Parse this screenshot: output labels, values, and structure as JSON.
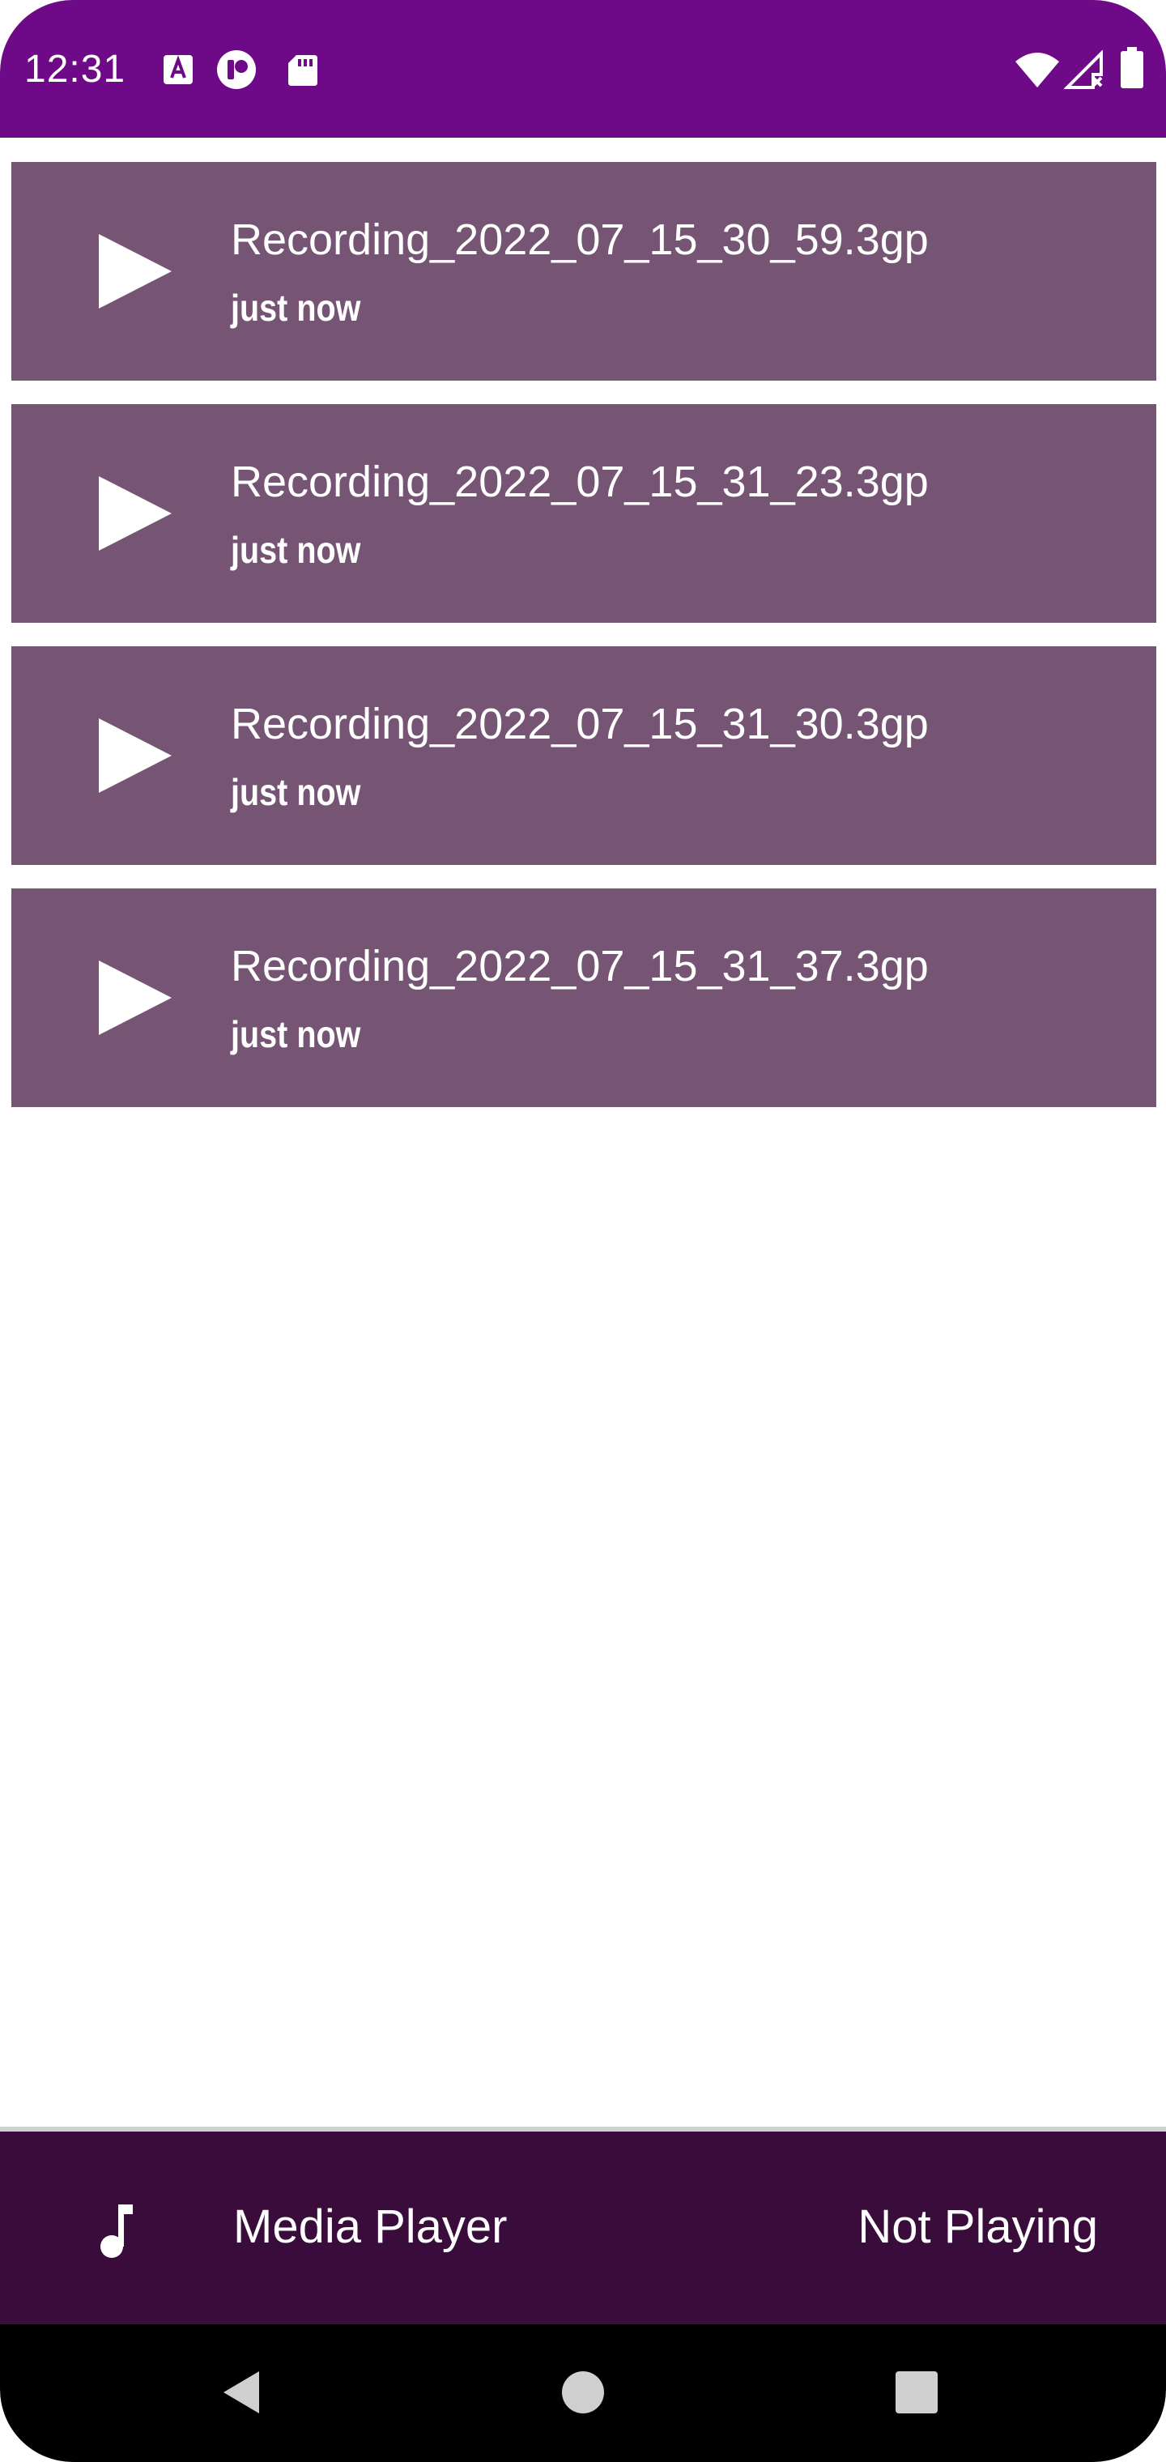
{
  "status_bar": {
    "time": "12:31",
    "background_color": "#6e0a87",
    "left_icons": [
      "text-notification-icon",
      "app-notification-icon",
      "sd-card-icon"
    ],
    "right_icons": [
      "wifi-icon",
      "cell-signal-no-data-icon",
      "battery-icon"
    ]
  },
  "recordings": {
    "item_color": "#755474",
    "items": [
      {
        "title": "Recording_2022_07_15_30_59.3gp",
        "subtitle": "just now",
        "icon": "play-icon"
      },
      {
        "title": "Recording_2022_07_15_31_23.3gp",
        "subtitle": "just now",
        "icon": "play-icon"
      },
      {
        "title": "Recording_2022_07_15_31_30.3gp",
        "subtitle": "just now",
        "icon": "play-icon"
      },
      {
        "title": "Recording_2022_07_15_31_37.3gp",
        "subtitle": "just now",
        "icon": "play-icon"
      }
    ]
  },
  "player": {
    "icon": "music-note-icon",
    "title": "Media Player",
    "status": "Not Playing",
    "background_color": "#3a0c3b"
  },
  "nav_bar": {
    "buttons": [
      "back-icon",
      "home-icon",
      "recents-icon"
    ]
  }
}
